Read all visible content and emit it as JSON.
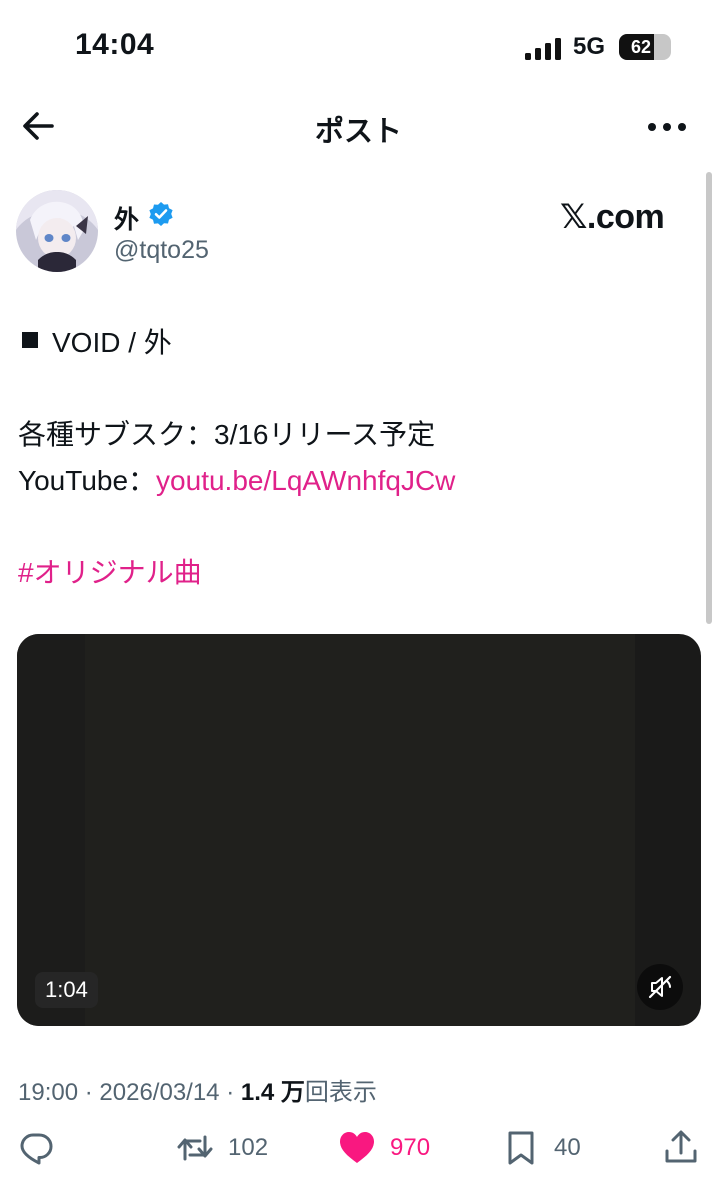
{
  "status": {
    "time": "14:04",
    "network": "5G",
    "battery": "62",
    "battery_level_percent": 62
  },
  "nav": {
    "title": "ポスト"
  },
  "author": {
    "display_name": "外",
    "handle": "@tqto25",
    "verified": true
  },
  "watermark": "𝕏.com",
  "post": {
    "title_line": "VOID / 外",
    "release_line": "各種サブスク：3/16リリース予定",
    "youtube_prefix": "YouTube：",
    "youtube_link": "youtu.be/LqAWnhfqJCw",
    "hashtag": "#オリジナル曲"
  },
  "video": {
    "duration": "1:04"
  },
  "meta": {
    "time": "19:00",
    "separator": "·",
    "date": "2026/03/14",
    "views_count": "1.4 万",
    "views_label": "回表示"
  },
  "actions": {
    "reposts": "102",
    "likes": "970",
    "bookmarks": "40"
  },
  "colors": {
    "link": "#e0218a",
    "like": "#f91880",
    "verified": "#1d9bf0",
    "muted_text": "#536471"
  }
}
